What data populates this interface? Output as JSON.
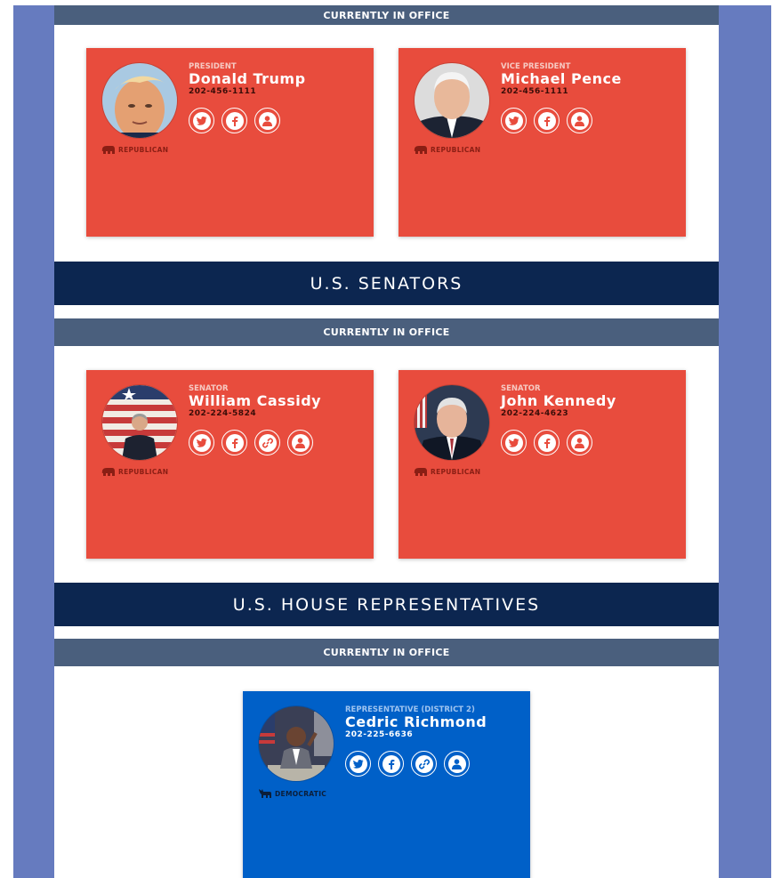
{
  "sections": {
    "senators_title": "U.S. SENATORS",
    "house_title": "U.S. HOUSE REPRESENTATIVES"
  },
  "office_label": "CURRENTLY IN OFFICE",
  "colors": {
    "republican_card": "#e84c3d",
    "democratic_card": "#0060c8",
    "section_bar": "#0c2650",
    "office_bar": "#4a5f7d",
    "page_frame": "#667bbf"
  },
  "executive": [
    {
      "role": "PRESIDENT",
      "name": "Donald Trump",
      "phone": "202-456-1111",
      "party": "REPUBLICAN",
      "icons": [
        "twitter-icon",
        "facebook-icon",
        "profile-icon"
      ]
    },
    {
      "role": "VICE PRESIDENT",
      "name": "Michael Pence",
      "phone": "202-456-1111",
      "party": "REPUBLICAN",
      "icons": [
        "twitter-icon",
        "facebook-icon",
        "profile-icon"
      ]
    }
  ],
  "senators": [
    {
      "role": "SENATOR",
      "name": "William Cassidy",
      "phone": "202-224-5824",
      "party": "REPUBLICAN",
      "icons": [
        "twitter-icon",
        "facebook-icon",
        "link-icon",
        "profile-icon"
      ]
    },
    {
      "role": "SENATOR",
      "name": "John Kennedy",
      "phone": "202-224-4623",
      "party": "REPUBLICAN",
      "icons": [
        "twitter-icon",
        "facebook-icon",
        "profile-icon"
      ]
    }
  ],
  "representatives": [
    {
      "role": "REPRESENTATIVE (DISTRICT 2)",
      "name": "Cedric Richmond",
      "phone": "202-225-6636",
      "party": "DEMOCRATIC",
      "icons": [
        "twitter-icon",
        "facebook-icon",
        "link-icon",
        "profile-icon"
      ]
    }
  ]
}
